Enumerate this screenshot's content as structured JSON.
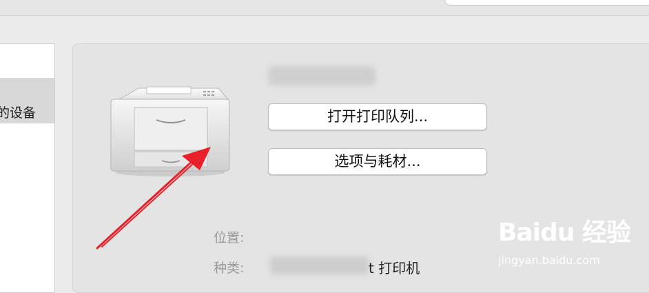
{
  "sidebar": {
    "selected_item_label": "的设备"
  },
  "printer_panel": {
    "printer_name": "",
    "open_queue_button": "打开打印队列...",
    "options_supplies_button": "选项与耗材...",
    "location_label": "位置:",
    "location_value": "",
    "kind_label": "种类:",
    "kind_value_suffix": "t 打印机"
  },
  "annotation": {
    "arrow_color": "#e8202a"
  },
  "watermark": {
    "brand": "Baidu 经验",
    "url": "jingyan.baidu.com"
  }
}
